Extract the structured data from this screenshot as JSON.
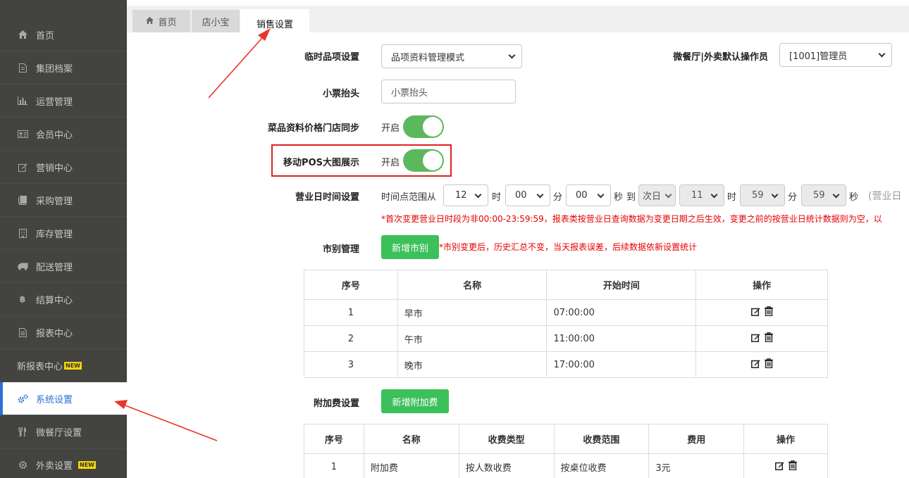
{
  "sidebar": {
    "items": [
      {
        "label": "首页",
        "icon": "home-icon"
      },
      {
        "label": "集团档案",
        "icon": "file-icon"
      },
      {
        "label": "运营管理",
        "icon": "bar-chart-icon"
      },
      {
        "label": "会员中心",
        "icon": "id-card-icon"
      },
      {
        "label": "营销中心",
        "icon": "edit-icon"
      },
      {
        "label": "采购管理",
        "icon": "book-icon"
      },
      {
        "label": "库存管理",
        "icon": "building-icon"
      },
      {
        "label": "配送管理",
        "icon": "truck-icon"
      },
      {
        "label": "结算中心",
        "icon": "bitcoin-icon"
      },
      {
        "label": "报表中心",
        "icon": "file-text-icon"
      },
      {
        "label": "新报表中心",
        "badge": "NEW"
      },
      {
        "label": "系统设置",
        "icon": "cogs-icon",
        "active": true
      },
      {
        "label": "微餐厅设置",
        "icon": "cutlery-icon"
      },
      {
        "label": "外卖设置",
        "icon": "cog-icon",
        "badge": "NEW"
      }
    ]
  },
  "tabs": [
    {
      "label": "首页",
      "icon": "home-icon"
    },
    {
      "label": "店小宝"
    },
    {
      "label": "销售设置",
      "active": true
    }
  ],
  "form": {
    "temp_item": {
      "label": "临时品项设置",
      "value": "品项资料管理模式"
    },
    "micro_operator": {
      "label": "微餐厅|外卖默认操作员",
      "value": "[1001]管理员"
    },
    "receipt_header": {
      "label": "小票抬头",
      "value": "小票抬头"
    },
    "price_sync": {
      "label": "菜品资料价格门店同步",
      "state_text": "开启"
    },
    "mobile_pos": {
      "label": "移动POS大图展示",
      "state_text": "开启"
    },
    "business_day": {
      "label": "营业日时间设置",
      "range_from": "时间点范围从",
      "start_h": "12",
      "h": "时",
      "start_m": "00",
      "m": "分",
      "start_s": "00",
      "s": "秒",
      "to": "到",
      "next_day": "次日",
      "end_h": "11",
      "h2": "时",
      "end_m": "59",
      "m2": "分",
      "end_s": "59",
      "s2": "秒",
      "tail": "(营业日",
      "note": "*首次变更营业日时段为非00:00-23:59:59，报表类按营业日查询数据为变更日期之后生效，变更之前的按营业日统计数据则为空，以"
    },
    "market": {
      "label": "市别管理",
      "add_button": "新增市别",
      "note": "*市别变更后，历史汇总不变，当天报表误差，后续数据依新设置统计"
    },
    "surcharge": {
      "label": "附加费设置",
      "add_button": "新增附加费"
    }
  },
  "market_table": {
    "headers": [
      "序号",
      "名称",
      "开始时间",
      "操作"
    ],
    "rows": [
      {
        "no": "1",
        "name": "早市",
        "start": "07:00:00"
      },
      {
        "no": "2",
        "name": "午市",
        "start": "11:00:00"
      },
      {
        "no": "3",
        "name": "晚市",
        "start": "17:00:00"
      }
    ]
  },
  "surcharge_table": {
    "headers": [
      "序号",
      "名称",
      "收费类型",
      "收费范围",
      "费用",
      "操作"
    ],
    "rows": [
      {
        "no": "1",
        "name": "附加费",
        "type": "按人数收费",
        "scope": "按桌位收费",
        "fee": "3元"
      }
    ]
  },
  "colors": {
    "accent": "#3cc05a",
    "active_blue": "#2f6fd6",
    "highlight": "#e02020"
  }
}
